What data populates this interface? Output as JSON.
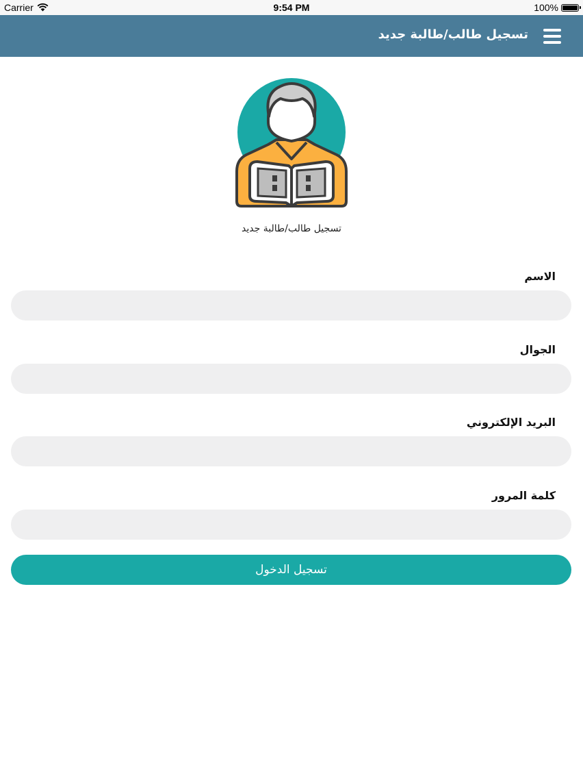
{
  "status_bar": {
    "carrier": "Carrier",
    "time": "9:54 PM",
    "battery": "100%"
  },
  "nav": {
    "title": "تسجيل طالب/طالبة جديد"
  },
  "hero": {
    "subtitle": "تسجيل طالب/طالبة جديد"
  },
  "form": {
    "name_label": "الاسم",
    "name_value": "",
    "mobile_label": "الجوال",
    "mobile_value": "",
    "email_label": "البريد الإلكتروني",
    "email_value": "",
    "password_label": "كلمة المرور",
    "password_value": "",
    "submit_label": "تسجيل الدخول"
  },
  "colors": {
    "nav_background": "#4a7c99",
    "accent": "#1aa9a6",
    "input_background": "#efeff0",
    "avatar_circle": "#1aa9a6",
    "avatar_shirt": "#fbb040"
  },
  "icons": {
    "menu": "hamburger-menu-icon",
    "avatar": "student-reading-book-icon",
    "wifi": "wifi-icon",
    "battery": "battery-icon"
  }
}
